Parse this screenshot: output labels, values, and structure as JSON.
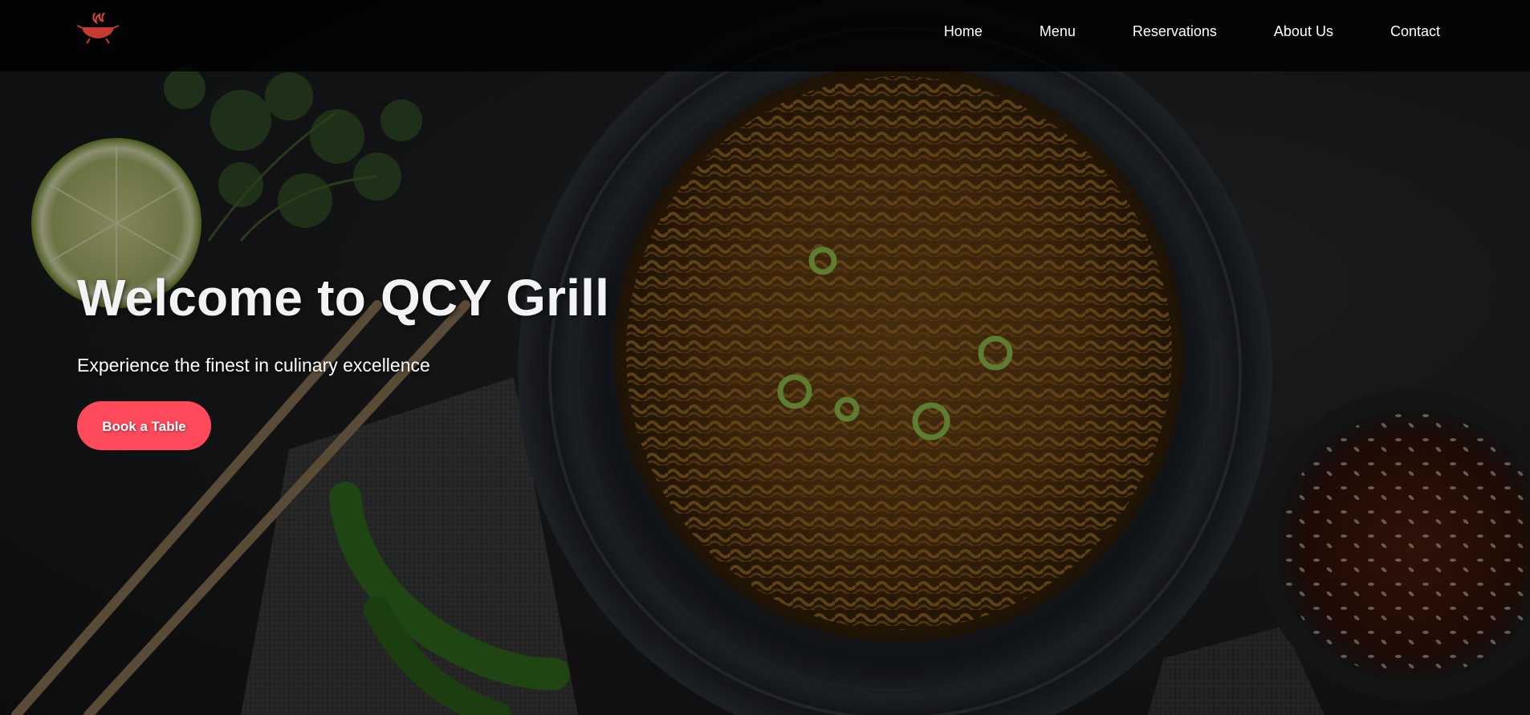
{
  "brand": {
    "logo_icon": "grill-flame-logo-icon",
    "accent_color": "#ff4a5b"
  },
  "nav": {
    "items": [
      {
        "label": "Home"
      },
      {
        "label": "Menu"
      },
      {
        "label": "Reservations"
      },
      {
        "label": "About Us"
      },
      {
        "label": "Contact"
      }
    ]
  },
  "hero": {
    "title": "Welcome to QCY Grill",
    "subtitle": "Experience the finest in culinary excellence",
    "cta_label": "Book a Table",
    "background": "noodle-bowl-photo"
  }
}
